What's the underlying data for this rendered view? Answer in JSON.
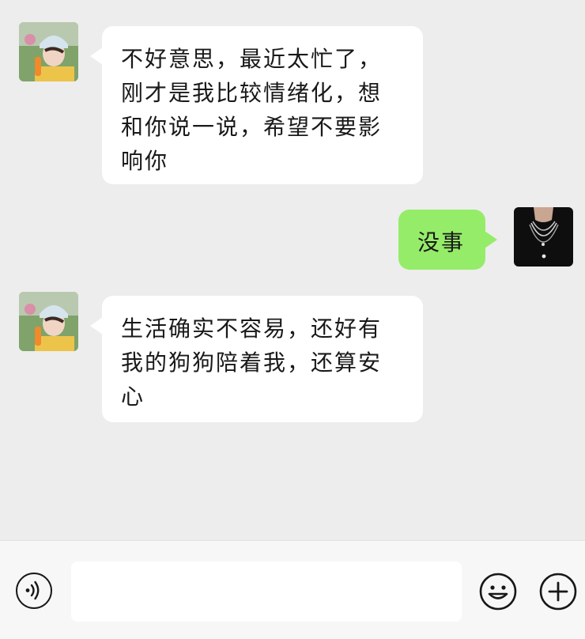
{
  "messages": [
    {
      "side": "in",
      "text": "不好意思，最近太忙了，刚才是我比较情绪化，想和你说一说，希望不要影响你"
    },
    {
      "side": "out",
      "text": "没事"
    },
    {
      "side": "in",
      "text": "生活确实不容易，还好有我的狗狗陪着我，还算安心"
    }
  ],
  "input": {
    "value": "",
    "placeholder": ""
  },
  "icons": {
    "voice": "voice-icon",
    "emoji": "smiley-icon",
    "plus": "plus-icon"
  },
  "colors": {
    "background": "#EDEDED",
    "incoming_bubble": "#FFFFFF",
    "outgoing_bubble": "#95EC69",
    "text": "#191919"
  }
}
